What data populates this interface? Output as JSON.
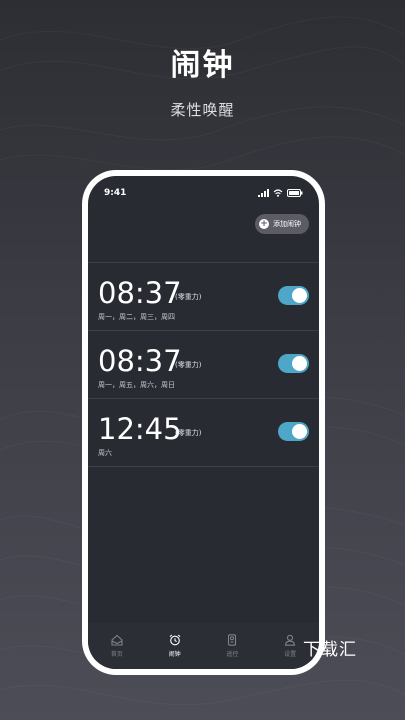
{
  "hero": {
    "title": "闹钟",
    "subtitle": "柔性唤醒"
  },
  "phone": {
    "status_time": "9:41",
    "add_alarm_label": "添加闹钟",
    "alarms": [
      {
        "time": "08:37",
        "mode": "(零重力)",
        "days": "周一，周二，周三，周四",
        "enabled": true
      },
      {
        "time": "08:37",
        "mode": "(零重力)",
        "days": "周一，周五，周六，周日",
        "enabled": true
      },
      {
        "time": "12:45",
        "mode": "(零重力)",
        "days": "周六",
        "enabled": true
      }
    ],
    "tabs": [
      {
        "label": "首页",
        "icon": "home-icon",
        "active": false
      },
      {
        "label": "闹钟",
        "icon": "alarm-clock-icon",
        "active": true
      },
      {
        "label": "遥控",
        "icon": "remote-icon",
        "active": false
      },
      {
        "label": "设置",
        "icon": "profile-icon",
        "active": false
      }
    ]
  },
  "colors": {
    "toggle_on": "#4ea6c8",
    "screen_bg": "#292b33"
  },
  "watermark": "下载汇"
}
